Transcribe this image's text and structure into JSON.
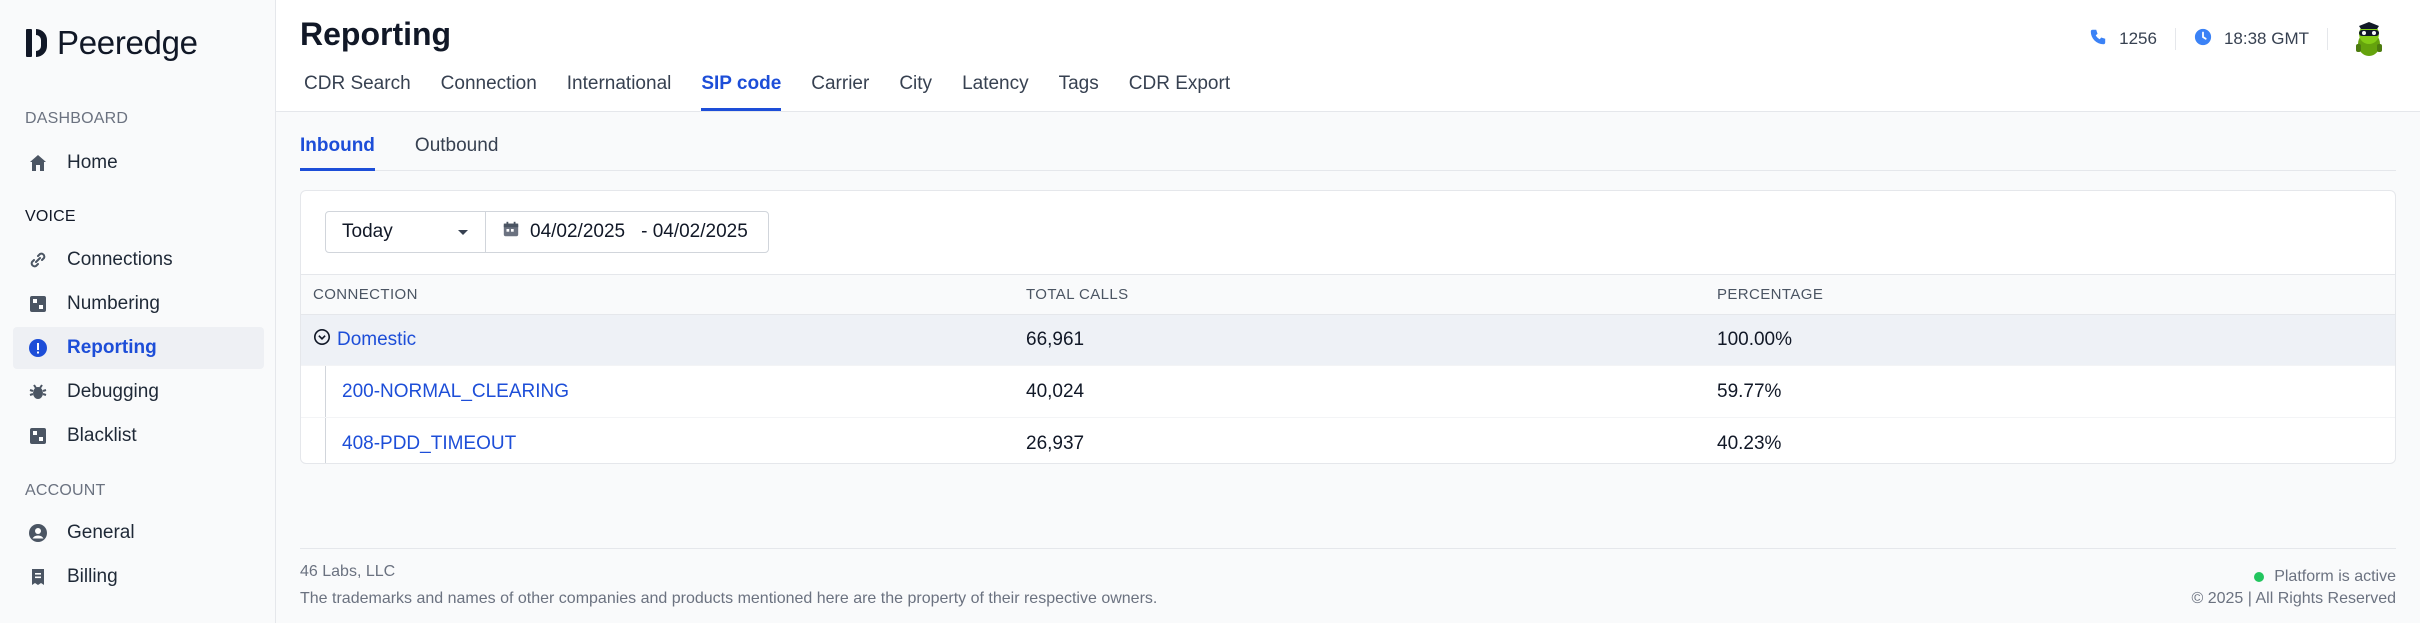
{
  "brand": {
    "name": "Peeredge"
  },
  "sidebar": {
    "sections": {
      "dashboard": "DASHBOARD",
      "voice": "VOICE",
      "account": "ACCOUNT"
    },
    "items": [
      {
        "label": "Home",
        "icon": "home-icon"
      },
      {
        "label": "Connections",
        "icon": "link-icon"
      },
      {
        "label": "Numbering",
        "icon": "grid-icon"
      },
      {
        "label": "Reporting",
        "icon": "alert-icon",
        "active": true
      },
      {
        "label": "Debugging",
        "icon": "bug-icon"
      },
      {
        "label": "Blacklist",
        "icon": "grid-icon"
      },
      {
        "label": "General",
        "icon": "user-circle-icon"
      },
      {
        "label": "Billing",
        "icon": "receipt-icon"
      }
    ]
  },
  "header": {
    "title": "Reporting",
    "tabs": [
      "CDR Search",
      "Connection",
      "International",
      "SIP code",
      "Carrier",
      "City",
      "Latency",
      "Tags",
      "CDR Export"
    ],
    "active_tab": "SIP code",
    "phone": "1256",
    "time": "18:38 GMT"
  },
  "subtabs": [
    "Inbound",
    "Outbound"
  ],
  "filters": {
    "period": "Today",
    "date_from": "04/02/2025",
    "date_to": "- 04/02/2025"
  },
  "table": {
    "columns": [
      "CONNECTION",
      "TOTAL CALLS",
      "PERCENTAGE"
    ],
    "group": {
      "name": "Domestic",
      "total": "66,961",
      "pct": "100.00%"
    },
    "rows": [
      {
        "name": "200-NORMAL_CLEARING",
        "total": "40,024",
        "pct": "59.77%"
      },
      {
        "name": "408-PDD_TIMEOUT",
        "total": "26,937",
        "pct": "40.23%"
      }
    ]
  },
  "footer": {
    "company": "46 Labs, LLC",
    "disclaimer": "The trademarks and names of other companies and products mentioned here are the property of their respective owners.",
    "status": "Platform is active",
    "copyright": "© 2025 | All Rights Reserved"
  },
  "colors": {
    "accent": "#1d4ed8",
    "status_ok": "#22c55e"
  }
}
